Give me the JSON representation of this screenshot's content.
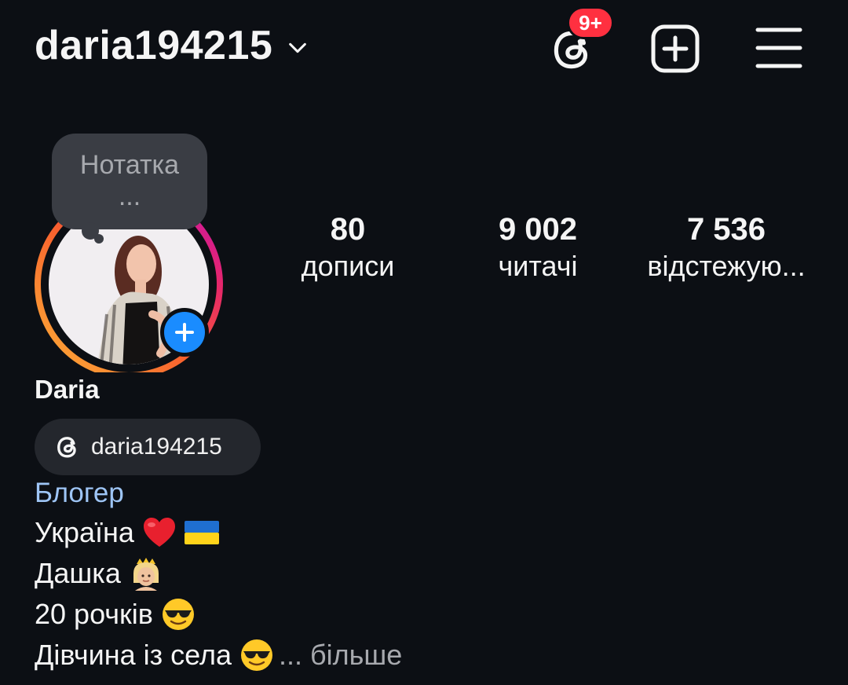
{
  "header": {
    "username": "daria194215",
    "threads_badge": "9+"
  },
  "note": {
    "placeholder": "Нотатка",
    "ellipsis": "..."
  },
  "stats": {
    "posts": {
      "value": "80",
      "label": "дописи"
    },
    "followers": {
      "value": "9 002",
      "label": "читачі"
    },
    "following": {
      "value": "7 536",
      "label": "відстежую..."
    }
  },
  "profile": {
    "name": "Daria",
    "threads_handle": "daria194215",
    "category": "Блогер",
    "bio": [
      {
        "text": "Україна",
        "emoji": [
          "red-heart",
          "ukraine-flag"
        ]
      },
      {
        "text": "Дашка",
        "emoji": [
          "princess"
        ]
      },
      {
        "text": "20 рочків",
        "emoji": [
          "sunglasses-face"
        ]
      },
      {
        "text": "Дівчина із села",
        "emoji": [
          "sunglasses-face"
        ],
        "more": "... більше"
      }
    ]
  },
  "colors": {
    "background": "#0c0f14",
    "badge": "#ff3040",
    "accent_blue": "#1a8cff",
    "category": "#9ec5f5",
    "chip_bg": "#24272d",
    "note_bg": "#3a3d44"
  }
}
